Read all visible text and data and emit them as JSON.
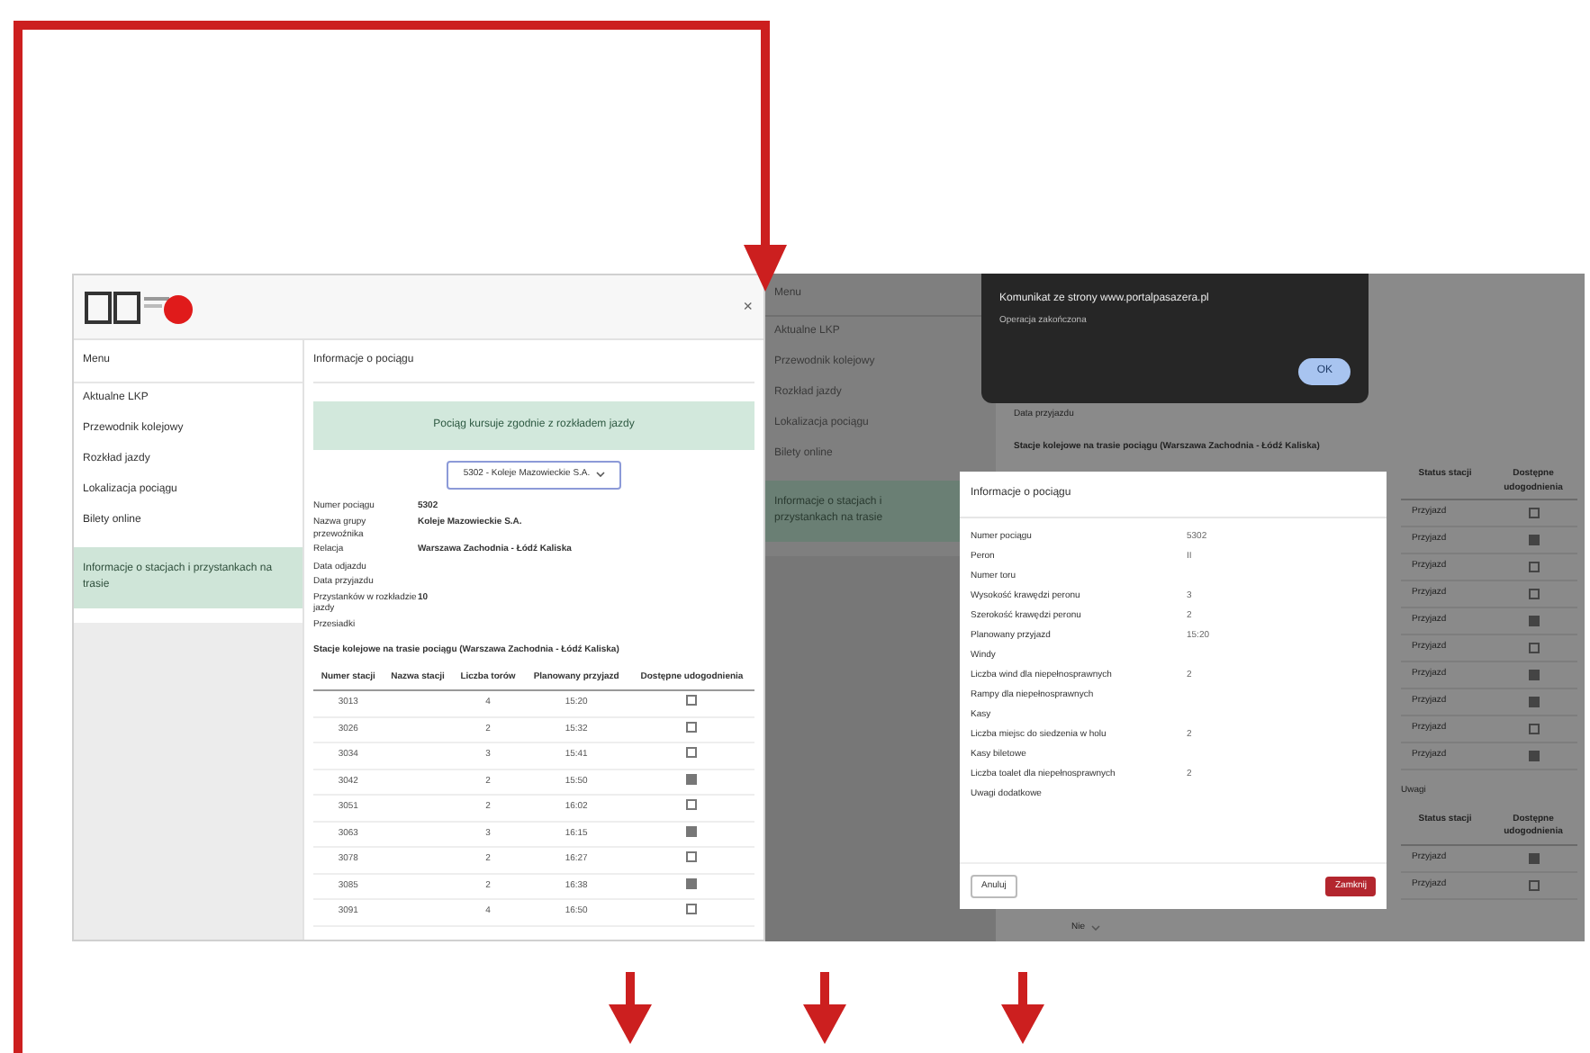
{
  "left_screen": {
    "close_label": "×",
    "sidebar": {
      "title": "Menu",
      "items": [
        {
          "label": "Aktualne LKP",
          "selected": false
        },
        {
          "label": "Przewodnik kolejowy",
          "selected": false
        },
        {
          "label": "Rozkład jazdy",
          "selected": false
        },
        {
          "label": "Lokalizacja pociągu",
          "selected": false
        },
        {
          "label": "Bilety online",
          "selected": false
        },
        {
          "label": "Informacje o stacjach i przystankach na trasie",
          "selected": true
        }
      ]
    },
    "content": {
      "title": "Informacje o pociągu",
      "banner": "Pociąg kursuje zgodnie z rozkładem jazdy",
      "select": "5302 - Koleje Mazowieckie S.A.",
      "details": [
        {
          "label": "Numer pociągu",
          "value": "5302"
        },
        {
          "label": "Nazwa grupy przewoźnika",
          "value": "Koleje Mazowieckie S.A."
        },
        {
          "label": "Relacja",
          "value": "Warszawa Zachodnia - Łódź Kaliska"
        },
        {
          "label": "Data odjazdu"
        },
        {
          "label": "Data przyjazdu"
        },
        {
          "label": "Przystanków w rozkładzie jazdy",
          "value": "10"
        },
        {
          "label": "Przesiadki"
        }
      ],
      "table_caption": "Stacje kolejowe na trasie pociągu (Warszawa Zachodnia - Łódź Kaliska)",
      "columns": [
        "Numer stacji",
        "Nazwa stacji",
        "Liczba torów",
        "Planowany przyjazd",
        "Dostępne udogodnienia"
      ],
      "rows": [
        {
          "cells": [
            "3013",
            "",
            "4",
            "15:20"
          ],
          "checked": false
        },
        {
          "cells": [
            "3026",
            "",
            "2",
            "15:32"
          ],
          "checked": false
        },
        {
          "cells": [
            "3034",
            "",
            "3",
            "15:41"
          ],
          "checked": false
        },
        {
          "cells": [
            "3042",
            "",
            "2",
            "15:50"
          ],
          "checked": true
        },
        {
          "cells": [
            "3051",
            "",
            "2",
            "16:02"
          ],
          "checked": false
        },
        {
          "cells": [
            "3063",
            "",
            "3",
            "16:15"
          ],
          "checked": true
        },
        {
          "cells": [
            "3078",
            "",
            "2",
            "16:27"
          ],
          "checked": false
        },
        {
          "cells": [
            "3085",
            "",
            "2",
            "16:38"
          ],
          "checked": true
        },
        {
          "cells": [
            "3091",
            "",
            "4",
            "16:50"
          ],
          "checked": false
        }
      ]
    }
  },
  "right_screen": {
    "sidebar": {
      "title": "Menu",
      "items": [
        {
          "label": "Aktualne LKP",
          "selected": false
        },
        {
          "label": "Przewodnik kolejowy",
          "selected": false
        },
        {
          "label": "Rozkład jazdy",
          "selected": false
        },
        {
          "label": "Lokalizacja pociągu",
          "selected": false
        },
        {
          "label": "Bilety online",
          "selected": false
        },
        {
          "label": "Informacje o stacjach i przystankach na trasie",
          "selected": true
        }
      ]
    },
    "alert": {
      "message": "Komunikat ze strony www.portalpasazera.pl",
      "detail": "Operacja zakończona",
      "button": "OK"
    },
    "content_line": "Data przyjazdu",
    "caption": "Stacje kolejowe na trasie pociągu (Warszawa Zachodnia - Łódź Kaliska)",
    "columns": [
      "Status stacji",
      "Dostępne udogodnienia"
    ],
    "rows": [
      {
        "status": "Przyjazd",
        "checked": false
      },
      {
        "status": "Przyjazd",
        "checked": true
      },
      {
        "status": "Przyjazd",
        "checked": false
      },
      {
        "status": "Przyjazd",
        "checked": false
      },
      {
        "status": "Przyjazd",
        "checked": true
      },
      {
        "status": "Przyjazd",
        "checked": false
      },
      {
        "status": "Przyjazd",
        "checked": true
      },
      {
        "status": "Przyjazd",
        "checked": true
      },
      {
        "status": "Przyjazd",
        "checked": false
      },
      {
        "status": "Przyjazd",
        "checked": true
      }
    ],
    "section_label": "Uwagi",
    "columns_2": [
      "Status stacji",
      "Dostępne udogodnienia"
    ],
    "rows_2": [
      {
        "status": "Przyjazd",
        "checked": true
      },
      {
        "status": "Przyjazd",
        "checked": false
      }
    ],
    "bottom_select": "Nie",
    "modal": {
      "title": "Informacje o pociągu",
      "rows": [
        {
          "label": "Numer pociągu",
          "value": "5302"
        },
        {
          "label": "Peron",
          "value": "II"
        },
        {
          "label": "Numer toru"
        },
        {
          "label": "Wysokość krawędzi peronu",
          "value": "3"
        },
        {
          "label": "Szerokość krawędzi peronu",
          "value": "2"
        },
        {
          "label": "Planowany przyjazd",
          "value": "15:20"
        },
        {
          "label": "Windy"
        },
        {
          "label": "Liczba wind dla niepełnosprawnych",
          "value": "2"
        },
        {
          "label": "Rampy dla niepełnosprawnych"
        },
        {
          "label": "Kasy"
        },
        {
          "label": "Liczba miejsc do siedzenia w holu",
          "value": "2"
        },
        {
          "label": "Kasy biletowe"
        },
        {
          "label": "Liczba toalet dla niepełnosprawnych",
          "value": "2"
        },
        {
          "label": "Uwagi dodatkowe"
        }
      ],
      "cancel": "Anuluj",
      "confirm": "Zamknij"
    }
  }
}
